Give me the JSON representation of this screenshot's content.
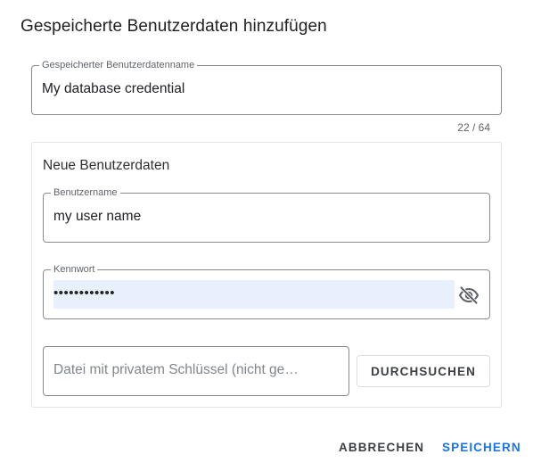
{
  "dialog": {
    "title": "Gespeicherte Benutzerdaten hinzufügen"
  },
  "credential_name": {
    "label": "Gespeicherter Benutzerdatenname",
    "value": "My database credential",
    "counter": "22 / 64"
  },
  "new_credentials": {
    "title": "Neue Benutzerdaten",
    "username": {
      "label": "Benutzername",
      "value": "my user name"
    },
    "password": {
      "label": "Kennwort",
      "masked_value": "••••••••••••",
      "toggle_icon": "eye-off-icon"
    },
    "private_key": {
      "placeholder": "Datei mit privatem Schlüssel (nicht ge…",
      "browse_label": "DURCHSUCHEN"
    }
  },
  "actions": {
    "cancel_label": "ABBRECHEN",
    "save_label": "SPEICHERN"
  },
  "colors": {
    "accent": "#1a73e8",
    "autofill_background": "#e8f0fe",
    "border": "#8a8a8a"
  }
}
